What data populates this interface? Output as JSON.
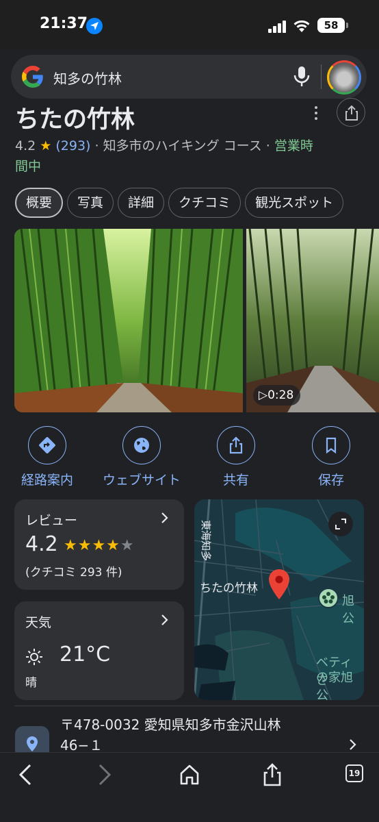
{
  "status_bar": {
    "time": "21:37",
    "battery": "58",
    "icons": [
      "location-arrow-icon",
      "signal-bars-icon",
      "wifi-icon",
      "battery-icon"
    ]
  },
  "search": {
    "query": "知多の竹林",
    "icons": [
      "google-logo-icon",
      "microphone-icon",
      "profile-avatar"
    ]
  },
  "place": {
    "title": "ちたの竹林",
    "rating": "4.2",
    "star": "★",
    "review_count": "(293)",
    "category": "· 知多市のハイキング コース ·",
    "open_status_1": "営業時",
    "open_status_2": "間中"
  },
  "tabs": [
    {
      "label": "概要",
      "active": true
    },
    {
      "label": "写真"
    },
    {
      "label": "詳細"
    },
    {
      "label": "クチコミ"
    },
    {
      "label": "観光スポット"
    }
  ],
  "media": {
    "video_duration": "0:28"
  },
  "actions": [
    {
      "label": "経路案内",
      "icon": "directions-icon"
    },
    {
      "label": "ウェブサイト",
      "icon": "globe-icon"
    },
    {
      "label": "共有",
      "icon": "share-icon"
    },
    {
      "label": "保存",
      "icon": "bookmark-icon"
    }
  ],
  "review_card": {
    "title": "レビュー",
    "rating": "4.2",
    "stars_on": "★★★★",
    "stars_off": "★",
    "count": "(クチコミ 293 件)"
  },
  "weather_card": {
    "title": "天気",
    "temperature": "21°C",
    "condition": "晴"
  },
  "map": {
    "road_label": "東海知多",
    "place_label": "ちたの竹林",
    "poi_1": "旭公",
    "poi_2_line1": "ベティさ",
    "poi_2_line2": "の家旭公"
  },
  "address": {
    "line1": "〒478-0032 愛知県知多市金沢山林",
    "line2": "46−１"
  },
  "toolbar": {
    "tab_count": "19"
  },
  "colors": {
    "background": "#202124",
    "surface": "#303134",
    "link_blue": "#8ab4f8",
    "open_green": "#81c995",
    "star_yellow": "#fbbc04",
    "map_pin_red": "#ea4335"
  }
}
